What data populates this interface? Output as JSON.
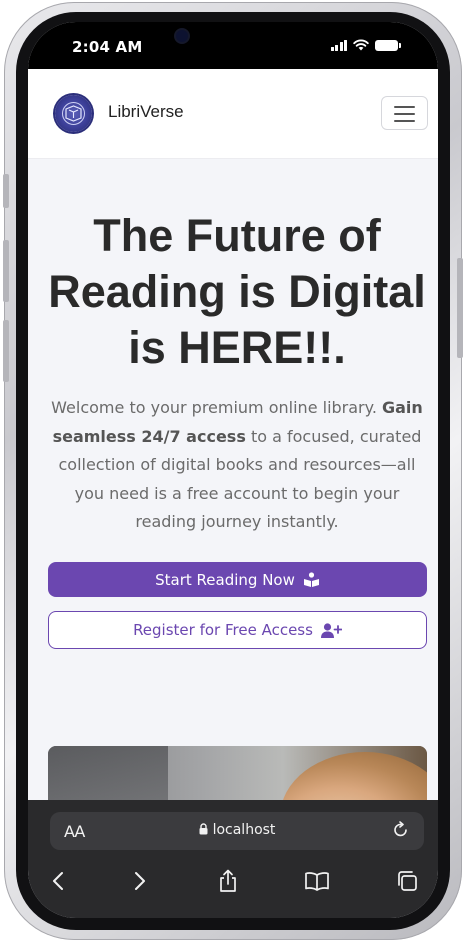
{
  "status_bar": {
    "time": "2:04 AM"
  },
  "navbar": {
    "brand": "LibriVerse"
  },
  "hero": {
    "title": "The Future of Reading is Digital is HERE!!.",
    "description_intro": "Welcome to your premium online library.",
    "description_bold": "Gain seamless 24/7 access",
    "description_rest": "to a focused, curated collection of digital books and resources—all you need is a free account to begin your reading journey instantly.",
    "primary_button": "Start Reading Now",
    "secondary_button": "Register for Free Access"
  },
  "browser": {
    "text_size_label": "AA",
    "url": "localhost"
  },
  "colors": {
    "accent": "#6b47b0",
    "page_bg": "#f4f5f9",
    "heading": "#2a2a2a",
    "body_text": "#6b6b6b",
    "browser_chrome": "#2a2a2c"
  },
  "icons": {
    "primary_button": "book-reader-icon",
    "secondary_button": "user-plus-icon",
    "toolbar": [
      "back-icon",
      "forward-icon",
      "share-icon",
      "bookmarks-icon",
      "tabs-icon"
    ]
  }
}
